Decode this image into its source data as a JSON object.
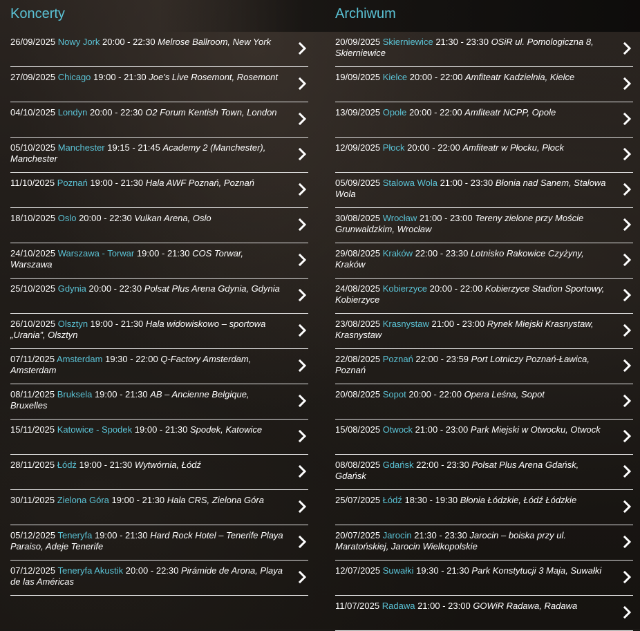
{
  "concerts": {
    "title": "Koncerty",
    "events": [
      {
        "date": "26/09/2025",
        "city": "Nowy Jork",
        "time": "20:00 - 22:30",
        "venue": "Melrose Ballroom, New York"
      },
      {
        "date": "27/09/2025",
        "city": "Chicago",
        "time": "19:00 - 21:30",
        "venue": "Joe's Live Rosemont, Rosemont"
      },
      {
        "date": "04/10/2025",
        "city": "Londyn",
        "time": "20:00 - 22:30",
        "venue": "O2 Forum Kentish Town, London"
      },
      {
        "date": "05/10/2025",
        "city": "Manchester",
        "time": "19:15 - 21:45",
        "venue": "Academy 2 (Manchester), Manchester"
      },
      {
        "date": "11/10/2025",
        "city": "Poznań",
        "time": "19:00 - 21:30",
        "venue": "Hala AWF Poznań, Poznań"
      },
      {
        "date": "18/10/2025",
        "city": "Oslo",
        "time": "20:00 - 22:30",
        "venue": "Vulkan Arena, Oslo"
      },
      {
        "date": "24/10/2025",
        "city": "Warszawa - Torwar",
        "time": "19:00 - 21:30",
        "venue": "COS Torwar, Warszawa"
      },
      {
        "date": "25/10/2025",
        "city": "Gdynia",
        "time": "20:00 - 22:30",
        "venue": "Polsat Plus Arena Gdynia, Gdynia"
      },
      {
        "date": "26/10/2025",
        "city": "Olsztyn",
        "time": "19:00 - 21:30",
        "venue": "Hala widowiskowo – sportowa „Urania”, Olsztyn"
      },
      {
        "date": "07/11/2025",
        "city": "Amsterdam",
        "time": "19:30 - 22:00",
        "venue": "Q-Factory Amsterdam, Amsterdam"
      },
      {
        "date": "08/11/2025",
        "city": "Bruksela",
        "time": "19:00 - 21:30",
        "venue": "AB – Ancienne Belgique, Bruxelles"
      },
      {
        "date": "15/11/2025",
        "city": "Katowice - Spodek",
        "time": "19:00 - 21:30",
        "venue": "Spodek, Katowice"
      },
      {
        "date": "28/11/2025",
        "city": "Łódź",
        "time": "19:00 - 21:30",
        "venue": "Wytwórnia, Łódź"
      },
      {
        "date": "30/11/2025",
        "city": "Zielona Góra",
        "time": "19:00 - 21:30",
        "venue": "Hala CRS, Zielona Góra"
      },
      {
        "date": "05/12/2025",
        "city": "Teneryfa",
        "time": "19:00 - 21:30",
        "venue": "Hard Rock Hotel – Tenerife Playa Paraiso, Adeje Tenerife"
      },
      {
        "date": "07/12/2025",
        "city": "Teneryfa Akustik",
        "time": "20:00 - 22:30",
        "venue": "Pirámide de Arona, Playa de las Américas"
      }
    ]
  },
  "archive": {
    "title": "Archiwum",
    "events": [
      {
        "date": "20/09/2025",
        "city": "Skierniewice",
        "time": "21:30 - 23:30",
        "venue": "OSiR ul. Pomologiczna 8, Skierniewice"
      },
      {
        "date": "19/09/2025",
        "city": "Kielce",
        "time": "20:00 - 22:00",
        "venue": "Amfiteatr Kadzielnia, Kielce"
      },
      {
        "date": "13/09/2025",
        "city": "Opole",
        "time": "20:00 - 22:00",
        "venue": "Amfiteatr NCPP, Opole"
      },
      {
        "date": "12/09/2025",
        "city": "Płock",
        "time": "20:00 - 22:00",
        "venue": "Amfiteatr w Płocku, Płock"
      },
      {
        "date": "05/09/2025",
        "city": "Stalowa Wola",
        "time": "21:00 - 23:30",
        "venue": "Błonia nad Sanem, Stalowa Wola"
      },
      {
        "date": "30/08/2025",
        "city": "Wrocław",
        "time": "21:00 - 23:00",
        "venue": "Tereny zielone przy Moście Grunwaldzkim, Wrocław"
      },
      {
        "date": "29/08/2025",
        "city": "Kraków",
        "time": "22:00 - 23:30",
        "venue": "Lotnisko Rakowice Czyżyny, Kraków"
      },
      {
        "date": "24/08/2025",
        "city": "Kobierzyce",
        "time": "20:00 - 22:00",
        "venue": "Kobierzyce Stadion Sportowy, Kobierzyce"
      },
      {
        "date": "23/08/2025",
        "city": "Krasnystaw",
        "time": "21:00 - 23:00",
        "venue": "Rynek Miejski Krasnystaw, Krasnystaw"
      },
      {
        "date": "22/08/2025",
        "city": "Poznań",
        "time": "22:00 - 23:59",
        "venue": "Port Lotniczy Poznań-Ławica, Poznań"
      },
      {
        "date": "20/08/2025",
        "city": "Sopot",
        "time": "20:00 - 22:00",
        "venue": "Opera Leśna, Sopot"
      },
      {
        "date": "15/08/2025",
        "city": "Otwock",
        "time": "21:00 - 23:00",
        "venue": "Park Miejski w Otwocku, Otwock"
      },
      {
        "date": "08/08/2025",
        "city": "Gdańsk",
        "time": "22:00 - 23:30",
        "venue": "Polsat Plus Arena Gdańsk, Gdańsk"
      },
      {
        "date": "25/07/2025",
        "city": "Łódź",
        "time": "18:30 - 19:30",
        "venue": "Błonia Łódzkie, Łódź Łódzkie"
      },
      {
        "date": "20/07/2025",
        "city": "Jarocin",
        "time": "21:30 - 23:30",
        "venue": "Jarocin – boiska przy ul. Maratońskiej, Jarocin Wielkopolskie"
      },
      {
        "date": "12/07/2025",
        "city": "Suwałki",
        "time": "19:30 - 21:30",
        "venue": "Park Konstytucji 3 Maja, Suwałki"
      },
      {
        "date": "11/07/2025",
        "city": "Radawa",
        "time": "21:00 - 23:00",
        "venue": "GOWiR Radawa, Radawa"
      }
    ]
  },
  "colors": {
    "accent": "#5bc3d6",
    "text": "#ffffff",
    "divider": "#e6e6e6",
    "background": "#1b1815"
  },
  "icons": {
    "row_arrow": "chevron-right-icon"
  }
}
